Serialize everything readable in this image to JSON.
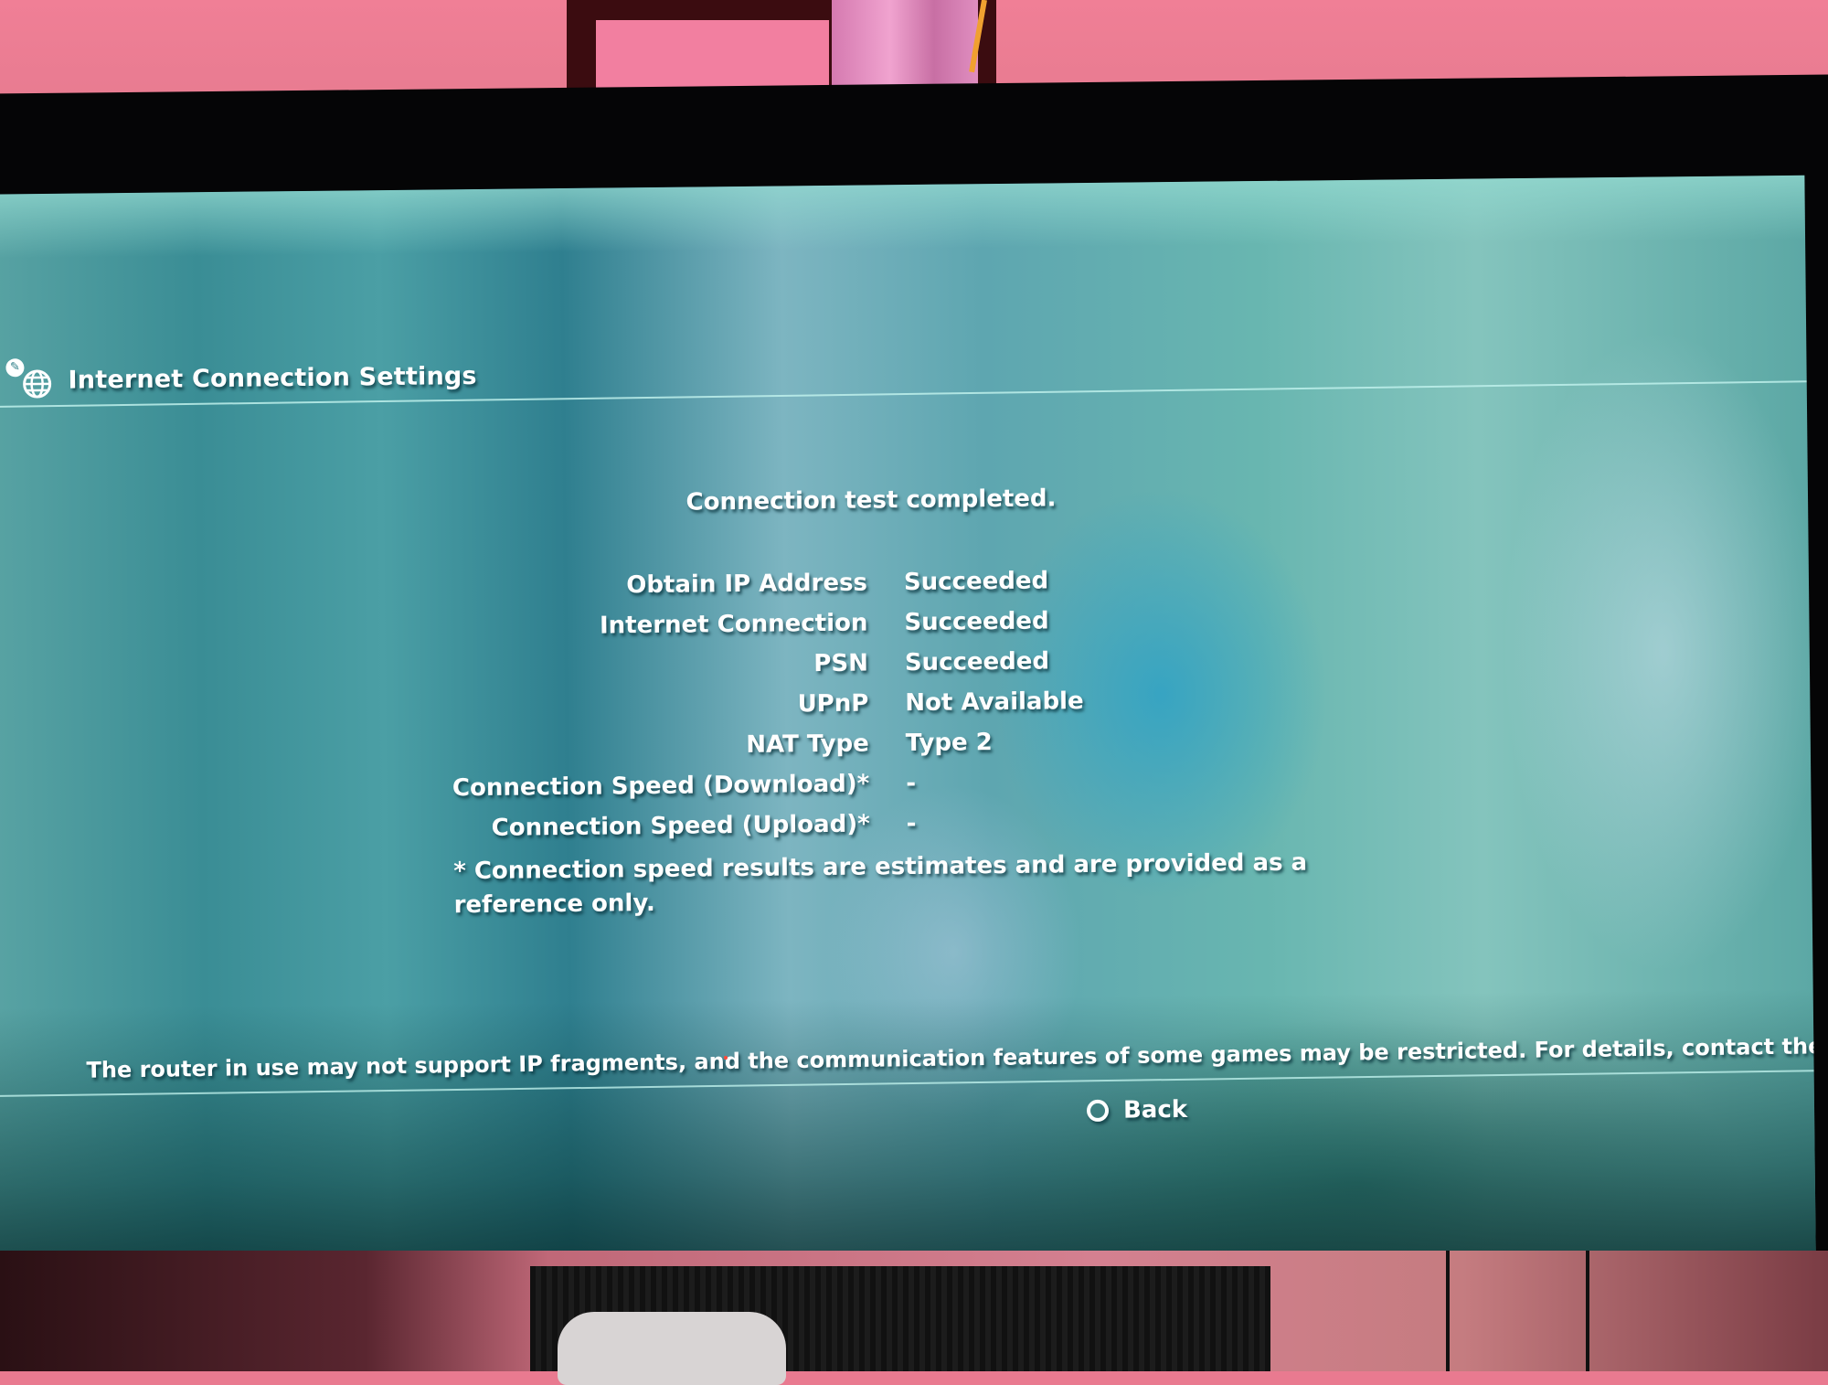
{
  "header": {
    "title": "Internet Connection Settings",
    "icons": [
      "wrench-icon",
      "globe-icon"
    ]
  },
  "status_message": "Connection test completed.",
  "results": [
    {
      "label": "Obtain IP Address",
      "value": "Succeeded"
    },
    {
      "label": "Internet Connection",
      "value": "Succeeded"
    },
    {
      "label": "PSN",
      "value": "Succeeded"
    },
    {
      "label": "UPnP",
      "value": "Not Available"
    },
    {
      "label": "NAT Type",
      "value": "Type 2"
    },
    {
      "label": "Connection Speed (Download)*",
      "value": "-"
    },
    {
      "label": "Connection Speed (Upload)*",
      "value": "-"
    }
  ],
  "footnote": "* Connection speed results are estimates and are provided as a reference only.",
  "warning": "The router in use may not support IP fragments, and the communication features of some games may be restricted. For details, contact the router manufacturer.",
  "back_button": {
    "icon": "circle-button-icon",
    "label": "Back"
  },
  "colors": {
    "text": "#ffffff",
    "divider": "#bef0eb",
    "screen_bg": "#4b9fa5",
    "wall": "#f07f96"
  }
}
